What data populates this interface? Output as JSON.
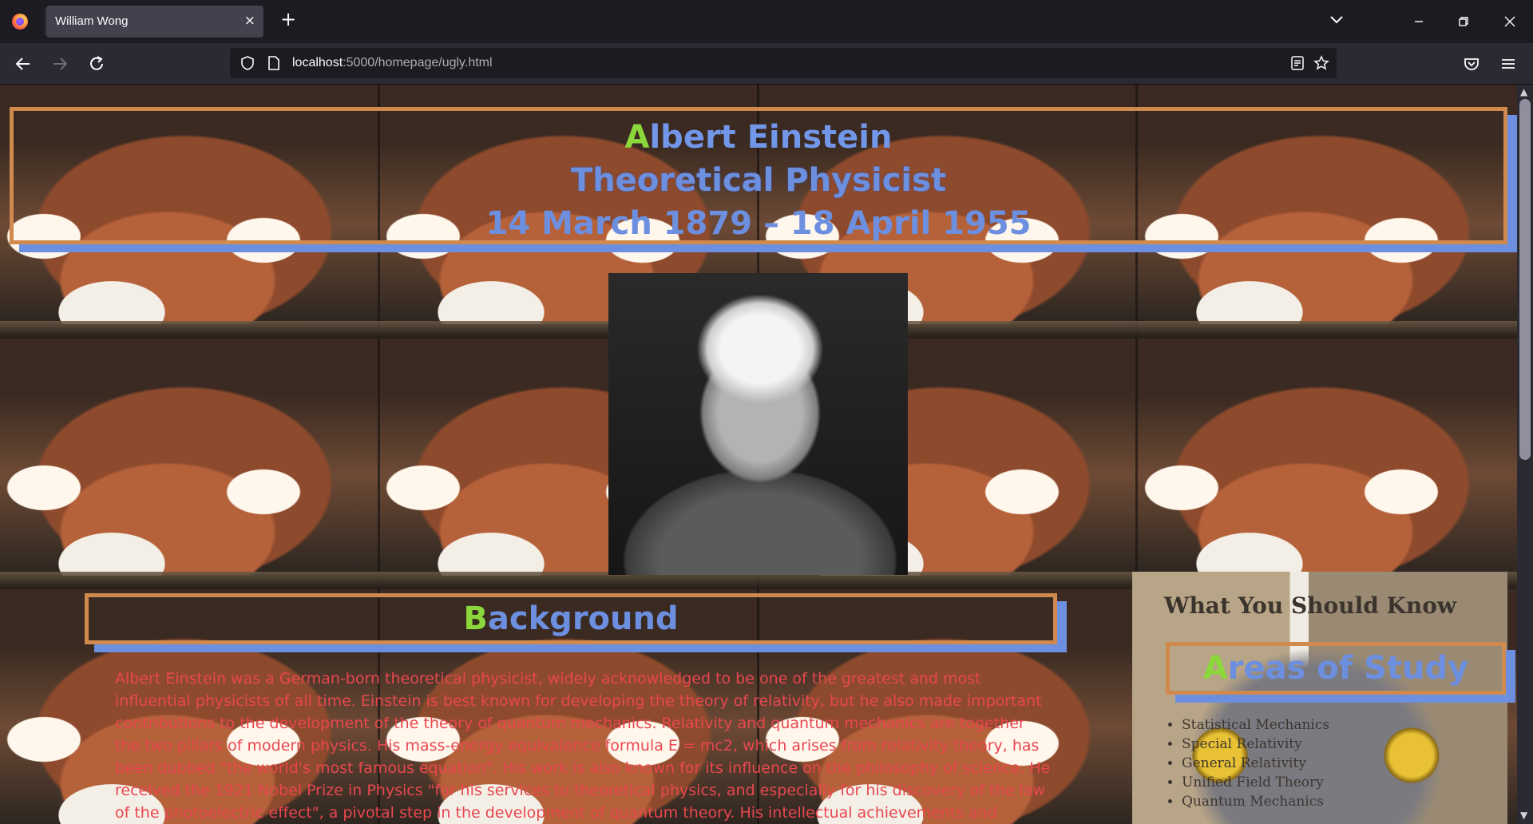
{
  "browser": {
    "tab_title": "William Wong",
    "tab_close": "×",
    "new_tab": "+",
    "url_host": "localhost",
    "url_rest": ":5000/homepage/ugly.html"
  },
  "header": {
    "name_first": "A",
    "name_rest": "lbert Einstein",
    "profession": "Theoretical Physicist",
    "dates": "14 March 1879 – 18 April 1955"
  },
  "background": {
    "heading_first": "B",
    "heading_rest": "ackground",
    "text": "Albert Einstein was a German-born theoretical physicist, widely acknowledged to be one of the greatest and most influential physicists of all time. Einstein is best known for developing the theory of relativity, but he also made important contributions to the development of the theory of quantum mechanics. Relativity and quantum mechanics are together the two pillars of modern physics. His mass-energy equivalence formula E = mc2, which arises from relativity theory, has been dubbed \"the world's most famous equation\". His work is also known for its influence on the philosophy of science. He received the 1921 Nobel Prize in Physics \"for his services to theoretical physics, and especially for his discovery of the law of the photoelectric effect\", a pivotal step in the development of quantum theory. His intellectual achievements and originality resulted in"
  },
  "sidebar": {
    "title": "What You Should Know",
    "areas_first": "A",
    "areas_rest": "reas of Study",
    "areas": [
      "Statistical Mechanics",
      "Special Relativity",
      "General Relativity",
      "Unified Field Theory",
      "Quantum Mechanics"
    ]
  },
  "colors": {
    "accent_blue": "#6d8fe0",
    "border_orange": "#d08a4e",
    "first_letter_green": "#8bd73c",
    "bio_red": "#e8474f"
  }
}
